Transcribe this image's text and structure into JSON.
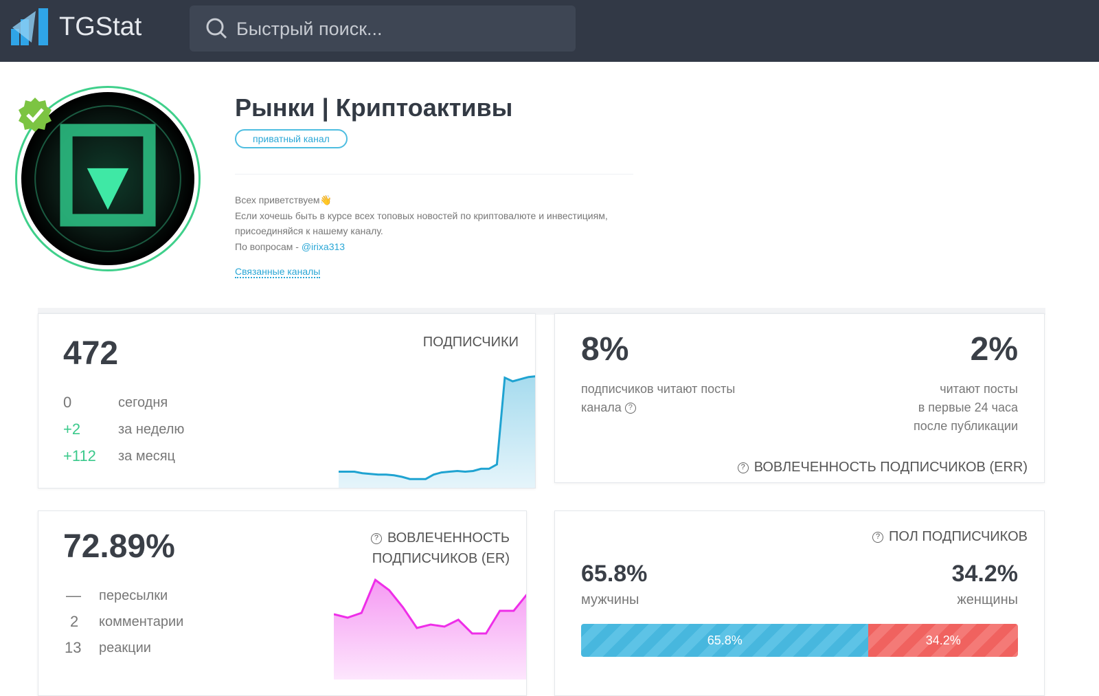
{
  "header": {
    "brand": "TGStat",
    "search_placeholder": "Быстрый поиск..."
  },
  "channel": {
    "title": "Рынки | Криптоактивы",
    "badge": "приватный канал",
    "description": [
      "Всех приветствуем👋",
      "Если хочешь быть в курсе всех топовых новостей по криптовалюте и инвестициям,",
      "присоединяйся к нашему каналу."
    ],
    "contact_prefix": "По вопросам - ",
    "contact_link": "@irixa313",
    "related_link": "Связанные каналы"
  },
  "subscribers": {
    "caption": "ПОДПИСЧИКИ",
    "total": "472",
    "rows": [
      {
        "value": "0",
        "label": "сегодня"
      },
      {
        "value": "+2",
        "label": "за неделю"
      },
      {
        "value": "+112",
        "label": "за месяц"
      }
    ],
    "sparkline": [
      24,
      24,
      24,
      22,
      21,
      20,
      20,
      19,
      17,
      14,
      14,
      14,
      20,
      23,
      24,
      25,
      24,
      25,
      28,
      28,
      34,
      153,
      148,
      151,
      154,
      155
    ]
  },
  "err": {
    "left_value": "8%",
    "left_label_1": "подписчиков читают посты",
    "left_label_2": "канала",
    "right_value": "2%",
    "right_label_1": "читают посты",
    "right_label_2": "в первые 24 часа",
    "right_label_3": "после публикации",
    "caption": "ВОВЛЕЧЕННОСТЬ ПОДПИСЧИКОВ (ERR)"
  },
  "er": {
    "value": "72.89%",
    "caption_1": "ВОВЛЕЧЕННОСТЬ",
    "caption_2": "ПОДПИСЧИКОВ (ER)",
    "rows": [
      {
        "value": "—",
        "label": "пересылки"
      },
      {
        "value": "2",
        "label": "комментарии"
      },
      {
        "value": "13",
        "label": "реакции"
      }
    ],
    "sparkline": [
      95,
      90,
      97,
      145,
      130,
      105,
      75,
      80,
      77,
      87,
      67,
      67,
      100,
      100,
      125
    ]
  },
  "gender": {
    "caption": "ПОЛ ПОДПИСЧИКОВ",
    "male_value": "65.8%",
    "male_label": "мужчины",
    "female_value": "34.2%",
    "female_label": "женщины",
    "male_pct": 65.8,
    "female_pct": 34.2,
    "male_bar_label": "65.8%",
    "female_bar_label": "34.2%"
  },
  "colors": {
    "header": "#323946",
    "accent": "#2aa7d6",
    "green": "#3ac98b",
    "male": "#47b7de",
    "female": "#f0625f",
    "er_line": "#ee2ee8"
  }
}
